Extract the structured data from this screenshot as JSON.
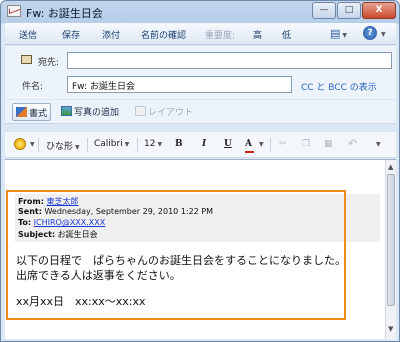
{
  "window": {
    "title": "Fw: お誕生日会"
  },
  "titlebar": {
    "minimize": "—",
    "maximize": "□",
    "close": "X"
  },
  "toolbar": {
    "send": "送信",
    "save": "保存",
    "attach": "添付",
    "check_names": "名前の確認",
    "importance": "重要度:",
    "high": "高",
    "low": "低",
    "options_icon": "options-icon",
    "help": "?"
  },
  "header": {
    "to_label": "宛先:",
    "to_value": "",
    "subject_label": "件名:",
    "subject_value": "Fw: お誕生日会",
    "cc_bcc_link": "CC と BCC の表示"
  },
  "insertbar": {
    "format": "書式",
    "add_photo": "写真の追加",
    "layout": "レイアウト"
  },
  "formatbar": {
    "stationery": "ひな形",
    "font": "Calibri",
    "size": "12",
    "bold": "B",
    "italic": "I",
    "underline": "U",
    "font_color": "A",
    "accent_color": "#d0201a"
  },
  "message": {
    "from_label": "From:",
    "from_value": "東芝太郎",
    "sent_label": "Sent:",
    "sent_value": "Wednesday, September 29, 2010 1:22 PM",
    "to_label": "To:",
    "to_value": "ICHIRO@XXX.XXX",
    "subject_label": "Subject:",
    "subject_value": "お誕生日会",
    "body_lines": [
      "以下の日程で　ぱらちゃんのお誕生日会をすることになりました。",
      "出席できる人は返事をください。",
      "xx月xx日　xx:xx～xx:xx"
    ]
  },
  "highlight_color": "#f08c1a"
}
